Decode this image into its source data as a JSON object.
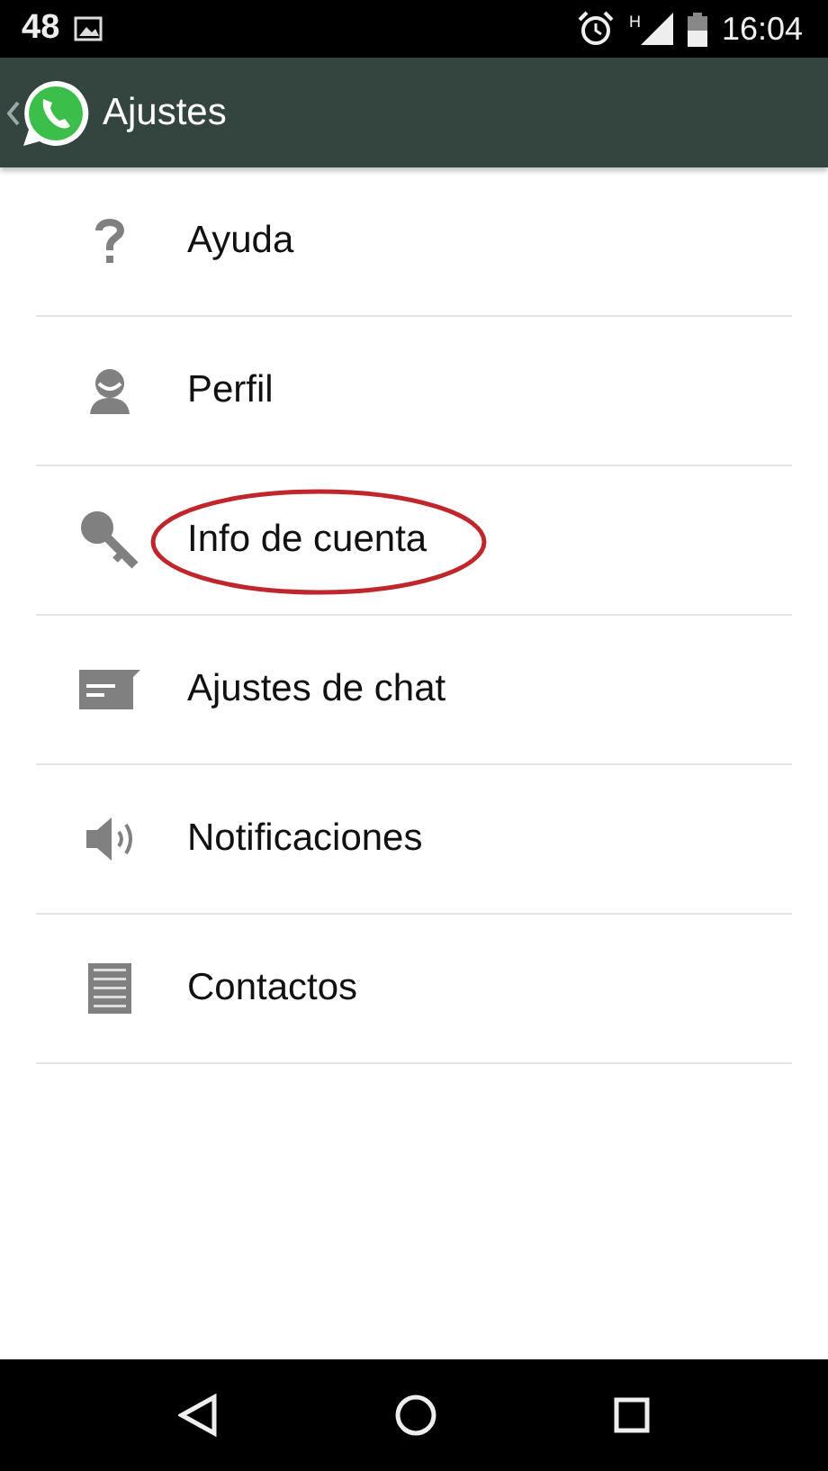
{
  "status_bar": {
    "notification_count": "48",
    "time": "16:04",
    "network_label": "H"
  },
  "header": {
    "title": "Ajustes"
  },
  "items": [
    {
      "kind": "help",
      "label": "Ayuda",
      "circled": false
    },
    {
      "kind": "profile",
      "label": "Perfil",
      "circled": false
    },
    {
      "kind": "key",
      "label": "Info de cuenta",
      "circled": true
    },
    {
      "kind": "chat",
      "label": "Ajustes de chat",
      "circled": false
    },
    {
      "kind": "speaker",
      "label": "Notificaciones",
      "circled": false
    },
    {
      "kind": "contacts",
      "label": "Contactos",
      "circled": false
    }
  ]
}
